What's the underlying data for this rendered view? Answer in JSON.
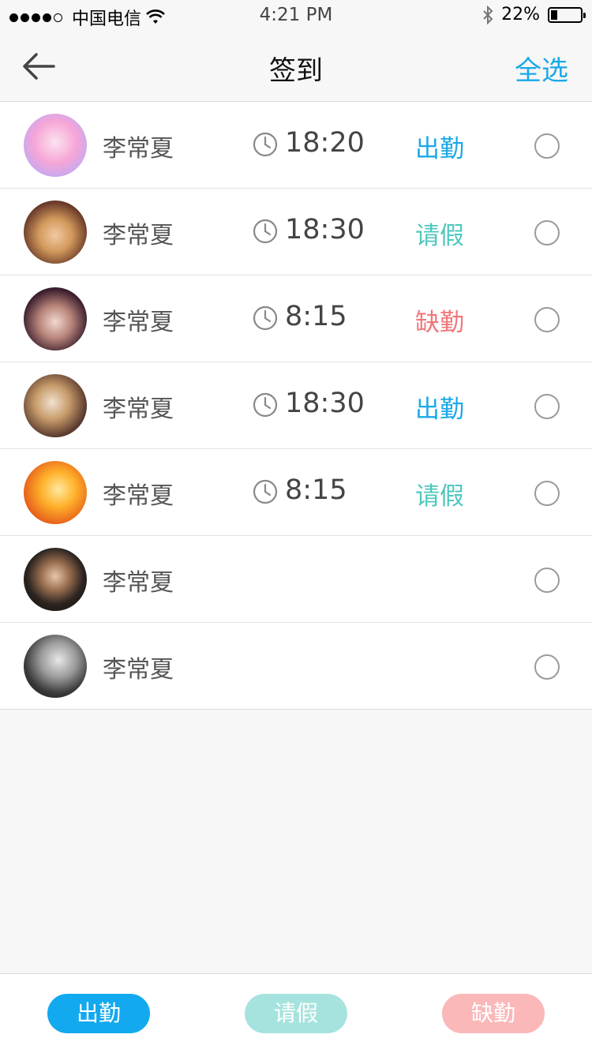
{
  "status_bar": {
    "carrier": "中国电信",
    "time": "4:21 PM",
    "battery": "22%",
    "battery_level": 0.22,
    "signal_bars": 4
  },
  "nav": {
    "title": "签到",
    "select_all": "全选"
  },
  "colors": {
    "present": "#1aa8e8",
    "leave": "#4fc7bd",
    "absent": "#f0777a"
  },
  "rows": [
    {
      "name": "李常夏",
      "time": "18:20",
      "status": "出勤",
      "status_type": "present"
    },
    {
      "name": "李常夏",
      "time": "18:30",
      "status": "请假",
      "status_type": "leave"
    },
    {
      "name": "李常夏",
      "time": "8:15",
      "status": "缺勤",
      "status_type": "absent"
    },
    {
      "name": "李常夏",
      "time": "18:30",
      "status": "出勤",
      "status_type": "present"
    },
    {
      "name": "李常夏",
      "time": "8:15",
      "status": "请假",
      "status_type": "leave"
    },
    {
      "name": "李常夏",
      "time": "",
      "status": "",
      "status_type": ""
    },
    {
      "name": "李常夏",
      "time": "",
      "status": "",
      "status_type": ""
    }
  ],
  "actions": {
    "present": "出勤",
    "leave": "请假",
    "absent": "缺勤"
  }
}
